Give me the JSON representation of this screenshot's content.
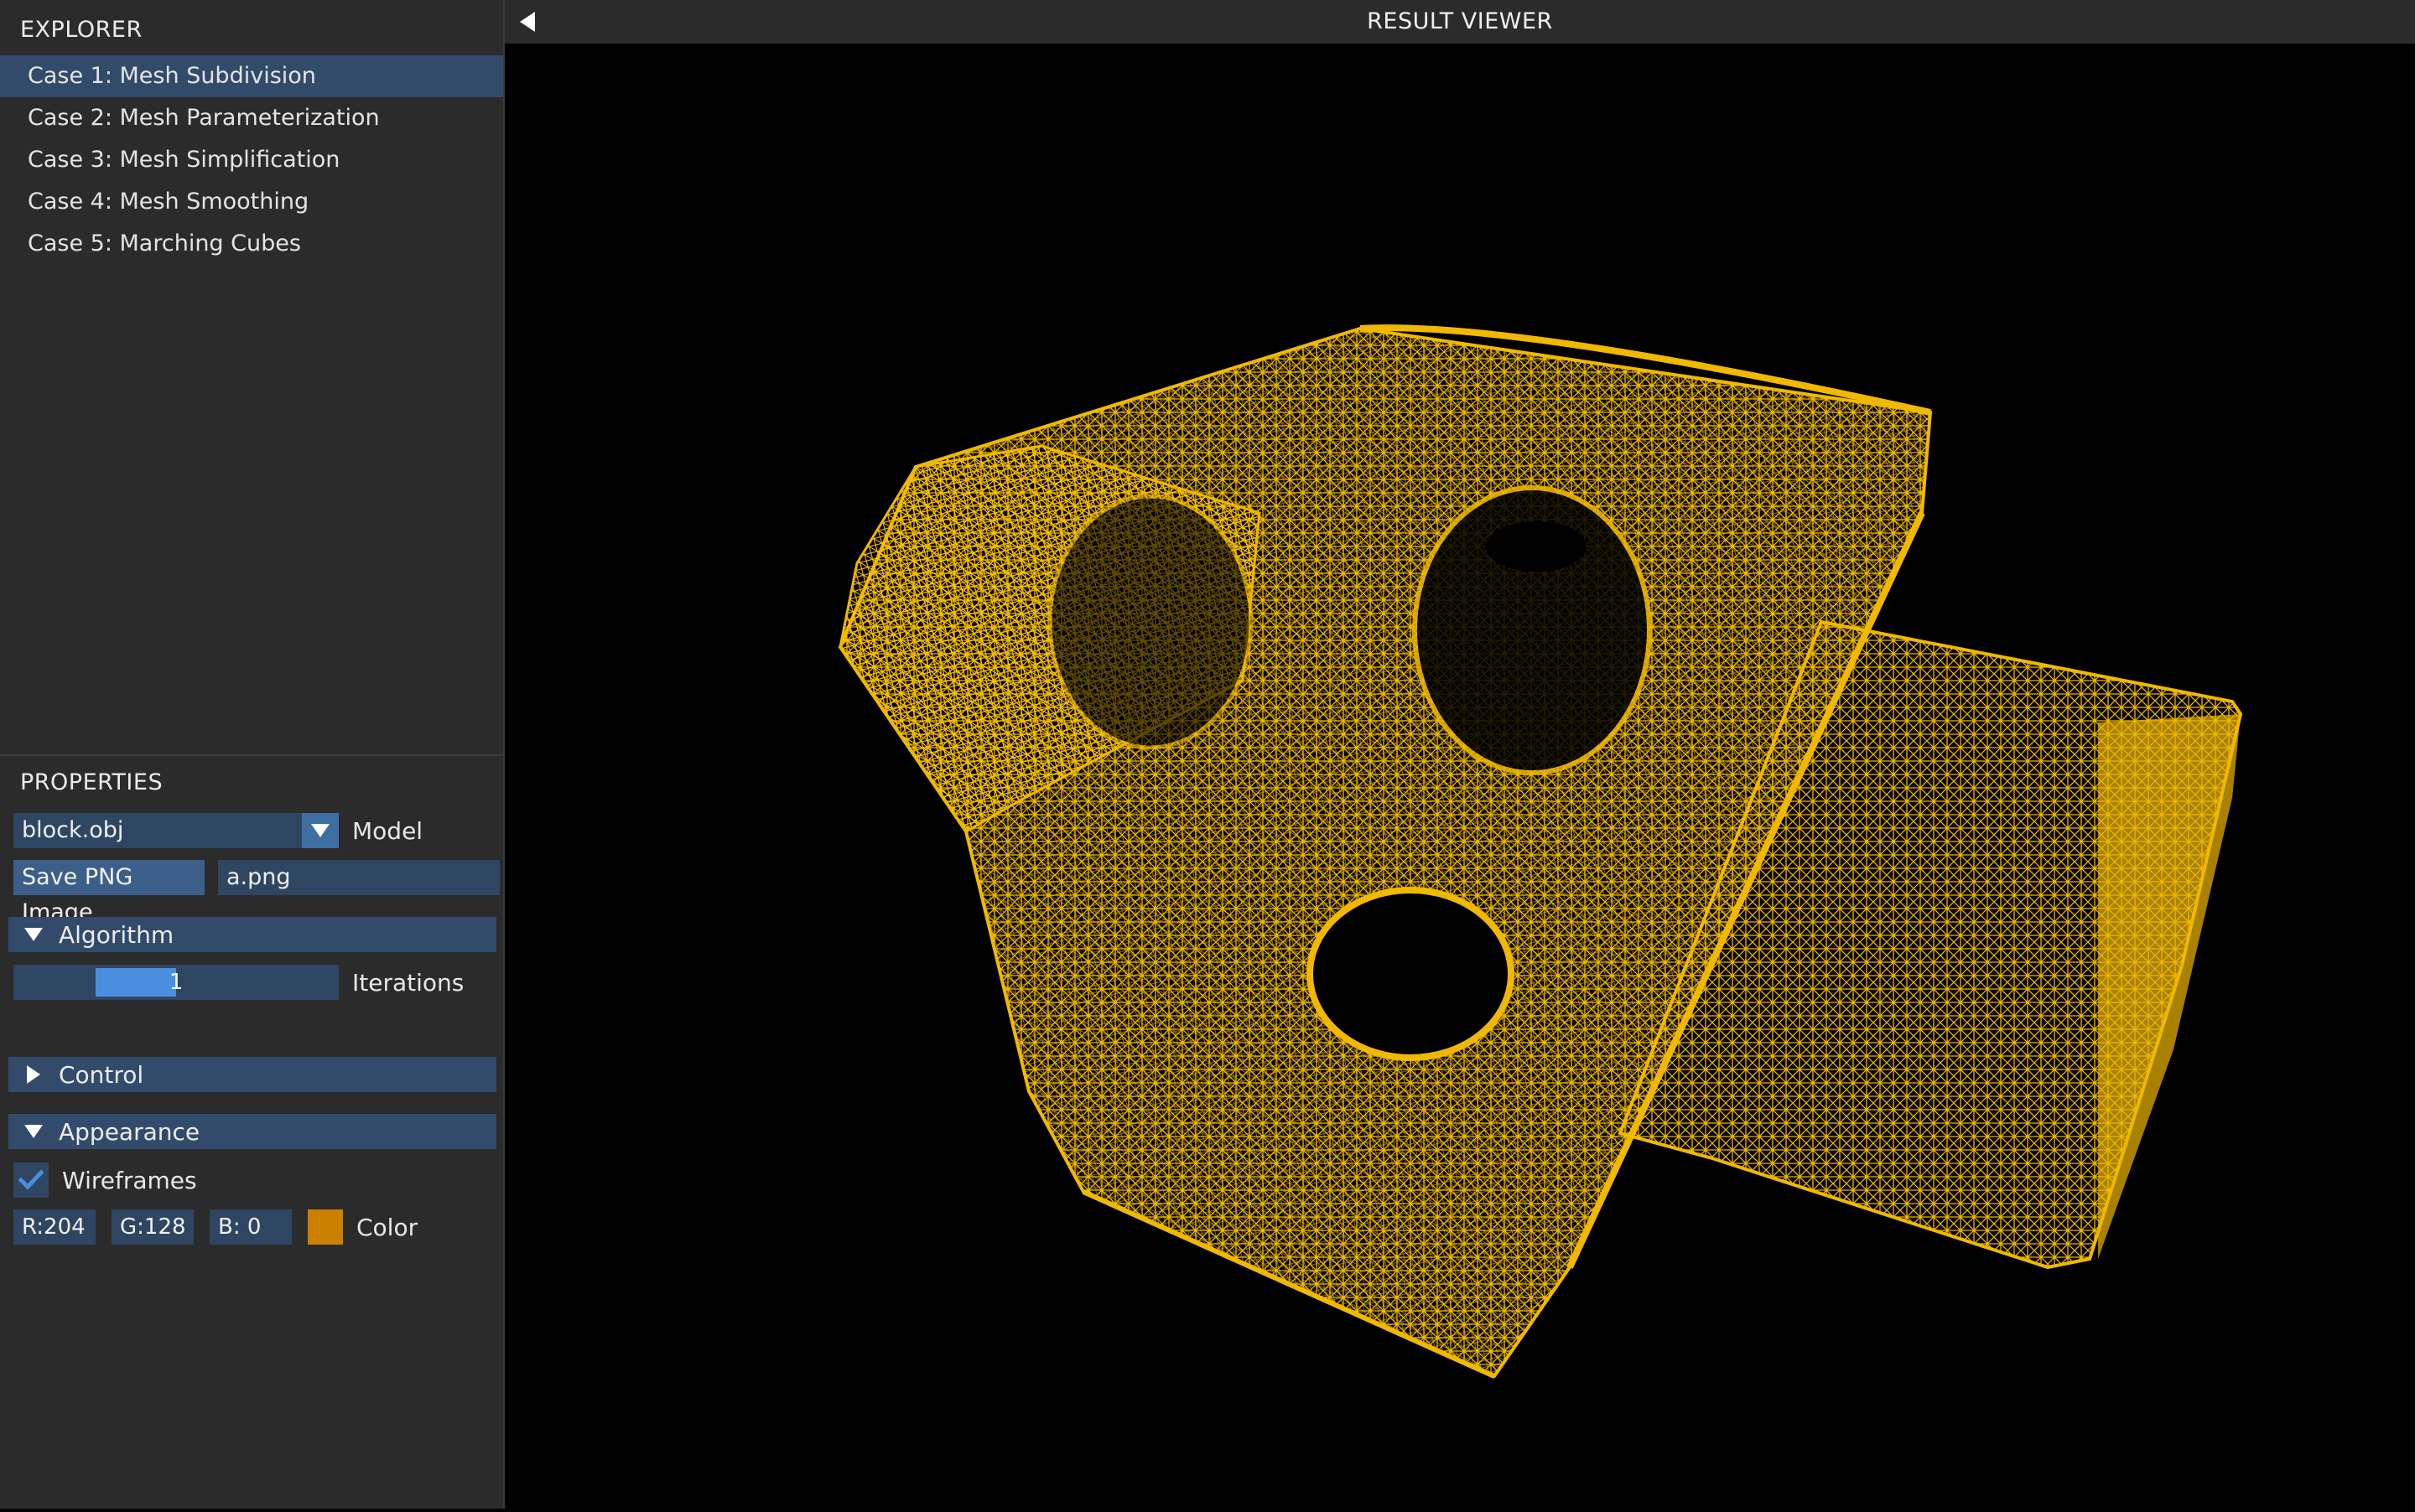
{
  "explorer": {
    "title": "EXPLORER",
    "items": [
      {
        "label": "Case 1: Mesh Subdivision",
        "selected": true
      },
      {
        "label": "Case 2: Mesh Parameterization",
        "selected": false
      },
      {
        "label": "Case 3: Mesh Simplification",
        "selected": false
      },
      {
        "label": "Case 4: Mesh Smoothing",
        "selected": false
      },
      {
        "label": "Case 5: Marching Cubes",
        "selected": false
      }
    ]
  },
  "properties": {
    "title": "PROPERTIES",
    "model": {
      "value": "block.obj",
      "label": "Model"
    },
    "save": {
      "button_label": "Save PNG Image",
      "filename": "a.png"
    },
    "algorithm": {
      "header": "Algorithm",
      "expanded": true,
      "iterations_value": "1",
      "iterations_label": "Iterations"
    },
    "control": {
      "header": "Control",
      "expanded": false
    },
    "appearance": {
      "header": "Appearance",
      "expanded": true,
      "wireframes": {
        "checked": true,
        "label": "Wireframes"
      },
      "color": {
        "r": "R:204",
        "g": "G:128",
        "b": "B:  0",
        "label": "Color",
        "swatch": "#cc8000"
      }
    }
  },
  "viewer": {
    "title": "RESULT VIEWER",
    "wire_color": "#f0b800",
    "background": "#000000"
  },
  "colors": {
    "panel_bg": "#2b2b2b",
    "selected_bg": "#324b6b",
    "field_bg": "#2f4663",
    "accent": "#4a8ee0"
  },
  "icons": {
    "collapse": "triangle-left-icon",
    "dropdown": "triangle-down-icon",
    "expanded": "triangle-down-icon",
    "collapsed": "triangle-right-icon",
    "check": "check-icon"
  }
}
